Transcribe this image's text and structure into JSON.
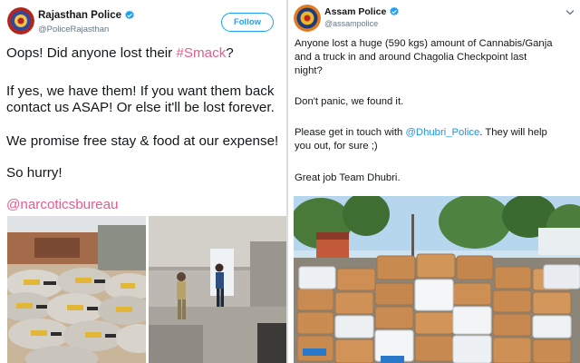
{
  "left_tweet": {
    "display_name": "Rajasthan Police",
    "handle": "@PoliceRajasthan",
    "follow_label": "Follow",
    "line1_pre": "Oops! Did anyone lost their ",
    "line1_hashtag": "#Smack",
    "line1_post": "?",
    "line2": "If yes, we have them! If you want them back",
    "line3": "contact us ASAP! Or else it'll be lost forever.",
    "line4": "We promise free stay & food at our expense!",
    "line5": "So hurry!",
    "mention": "@narcoticsbureau"
  },
  "right_tweet": {
    "display_name": "Assam Police",
    "handle": "@assampolice",
    "line1": "Anyone lost a huge (590 kgs) amount of Cannabis/Ganja",
    "line2": "and a truck in and around Chagolia Checkpoint last",
    "line3": "night?",
    "line4": "Don't panic, we found it.",
    "line5_pre": "Please get in touch with ",
    "line5_mention": "@Dhubri_Police",
    "line5_post": ". They will help",
    "line6": "you out, for sure ;)",
    "line7": "Great job Team Dhubri."
  },
  "colors": {
    "accent": "#1da1f2",
    "link": "#1b95e0",
    "hashtag_pink": "#e95a8e",
    "verified": "#1da1f2"
  },
  "icons": {
    "verified": "verified-badge-icon",
    "chevron": "chevron-down-icon"
  }
}
